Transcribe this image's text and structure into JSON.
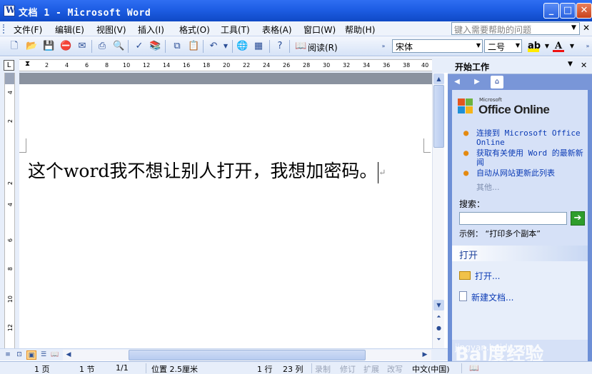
{
  "window": {
    "title": "文档 1 - Microsoft Word"
  },
  "menubar": {
    "items": [
      "文件(F)",
      "编辑(E)",
      "视图(V)",
      "插入(I)",
      "格式(O)",
      "工具(T)",
      "表格(A)",
      "窗口(W)",
      "帮助(H)"
    ],
    "help_placeholder": "键入需要帮助的问题"
  },
  "toolbar": {
    "read_label": "阅读(R)",
    "font_name": "宋体",
    "font_size": "二号"
  },
  "ruler": {
    "h_ticks": [
      "2",
      "4",
      "6",
      "8",
      "10",
      "12",
      "14",
      "16",
      "18",
      "20",
      "22",
      "24",
      "26",
      "28",
      "30",
      "32",
      "34",
      "36",
      "38",
      "40"
    ],
    "v_ticks": [
      "4",
      "2",
      "2",
      "4",
      "6",
      "8",
      "10",
      "12"
    ]
  },
  "document": {
    "text": "这个word我不想让别人打开，我想加密码。"
  },
  "taskpane": {
    "title": "开始工作",
    "logo_small": "Microsoft",
    "logo_big": "Office Online",
    "links": [
      "连接到 Microsoft Office Online",
      "获取有关使用 Word 的最新新闻",
      "自动从网站更新此列表"
    ],
    "more": "其他...",
    "search_label": "搜索：",
    "example": "示例：  “打印多个副本”",
    "open_header": "打开",
    "open_items": [
      "打开...",
      "新建文档..."
    ],
    "watermark": "Bai度经验",
    "watermark_url": "jingyan.baidu.com"
  },
  "statusbar": {
    "page": "1 页",
    "section": "1 节",
    "page_of": "1/1",
    "position": "位置 2.5厘米",
    "line": "1 行",
    "column": "23 列",
    "rec": "录制",
    "trk": "修订",
    "ext": "扩展",
    "ovr": "改写",
    "language": "中文(中国)"
  }
}
